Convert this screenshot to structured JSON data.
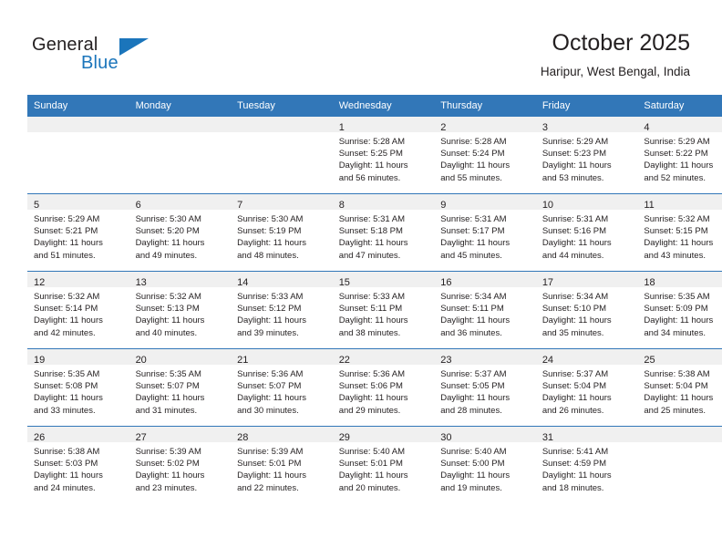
{
  "brand": {
    "line1": "General",
    "line2": "Blue",
    "triangle_color": "#1b75bb"
  },
  "header": {
    "title": "October 2025",
    "subtitle": "Haripur, West Bengal, India"
  },
  "theme": {
    "header_row_bg": "#3277b8",
    "daynum_bar_bg": "#f0f0f0",
    "grid_line": "#3277b8",
    "text": "#231f20"
  },
  "weekday_headers": [
    "Sunday",
    "Monday",
    "Tuesday",
    "Wednesday",
    "Thursday",
    "Friday",
    "Saturday"
  ],
  "labels": {
    "sunrise_prefix": "Sunrise:",
    "sunset_prefix": "Sunset:",
    "daylight_prefix": "Daylight:"
  },
  "weeks": [
    [
      {
        "empty": true
      },
      {
        "empty": true
      },
      {
        "empty": true
      },
      {
        "day": "1",
        "l1": "Sunrise: 5:28 AM",
        "l2": "Sunset: 5:25 PM",
        "l3": "Daylight: 11 hours",
        "l4": "and 56 minutes."
      },
      {
        "day": "2",
        "l1": "Sunrise: 5:28 AM",
        "l2": "Sunset: 5:24 PM",
        "l3": "Daylight: 11 hours",
        "l4": "and 55 minutes."
      },
      {
        "day": "3",
        "l1": "Sunrise: 5:29 AM",
        "l2": "Sunset: 5:23 PM",
        "l3": "Daylight: 11 hours",
        "l4": "and 53 minutes."
      },
      {
        "day": "4",
        "l1": "Sunrise: 5:29 AM",
        "l2": "Sunset: 5:22 PM",
        "l3": "Daylight: 11 hours",
        "l4": "and 52 minutes."
      }
    ],
    [
      {
        "day": "5",
        "l1": "Sunrise: 5:29 AM",
        "l2": "Sunset: 5:21 PM",
        "l3": "Daylight: 11 hours",
        "l4": "and 51 minutes."
      },
      {
        "day": "6",
        "l1": "Sunrise: 5:30 AM",
        "l2": "Sunset: 5:20 PM",
        "l3": "Daylight: 11 hours",
        "l4": "and 49 minutes."
      },
      {
        "day": "7",
        "l1": "Sunrise: 5:30 AM",
        "l2": "Sunset: 5:19 PM",
        "l3": "Daylight: 11 hours",
        "l4": "and 48 minutes."
      },
      {
        "day": "8",
        "l1": "Sunrise: 5:31 AM",
        "l2": "Sunset: 5:18 PM",
        "l3": "Daylight: 11 hours",
        "l4": "and 47 minutes."
      },
      {
        "day": "9",
        "l1": "Sunrise: 5:31 AM",
        "l2": "Sunset: 5:17 PM",
        "l3": "Daylight: 11 hours",
        "l4": "and 45 minutes."
      },
      {
        "day": "10",
        "l1": "Sunrise: 5:31 AM",
        "l2": "Sunset: 5:16 PM",
        "l3": "Daylight: 11 hours",
        "l4": "and 44 minutes."
      },
      {
        "day": "11",
        "l1": "Sunrise: 5:32 AM",
        "l2": "Sunset: 5:15 PM",
        "l3": "Daylight: 11 hours",
        "l4": "and 43 minutes."
      }
    ],
    [
      {
        "day": "12",
        "l1": "Sunrise: 5:32 AM",
        "l2": "Sunset: 5:14 PM",
        "l3": "Daylight: 11 hours",
        "l4": "and 42 minutes."
      },
      {
        "day": "13",
        "l1": "Sunrise: 5:32 AM",
        "l2": "Sunset: 5:13 PM",
        "l3": "Daylight: 11 hours",
        "l4": "and 40 minutes."
      },
      {
        "day": "14",
        "l1": "Sunrise: 5:33 AM",
        "l2": "Sunset: 5:12 PM",
        "l3": "Daylight: 11 hours",
        "l4": "and 39 minutes."
      },
      {
        "day": "15",
        "l1": "Sunrise: 5:33 AM",
        "l2": "Sunset: 5:11 PM",
        "l3": "Daylight: 11 hours",
        "l4": "and 38 minutes."
      },
      {
        "day": "16",
        "l1": "Sunrise: 5:34 AM",
        "l2": "Sunset: 5:11 PM",
        "l3": "Daylight: 11 hours",
        "l4": "and 36 minutes."
      },
      {
        "day": "17",
        "l1": "Sunrise: 5:34 AM",
        "l2": "Sunset: 5:10 PM",
        "l3": "Daylight: 11 hours",
        "l4": "and 35 minutes."
      },
      {
        "day": "18",
        "l1": "Sunrise: 5:35 AM",
        "l2": "Sunset: 5:09 PM",
        "l3": "Daylight: 11 hours",
        "l4": "and 34 minutes."
      }
    ],
    [
      {
        "day": "19",
        "l1": "Sunrise: 5:35 AM",
        "l2": "Sunset: 5:08 PM",
        "l3": "Daylight: 11 hours",
        "l4": "and 33 minutes."
      },
      {
        "day": "20",
        "l1": "Sunrise: 5:35 AM",
        "l2": "Sunset: 5:07 PM",
        "l3": "Daylight: 11 hours",
        "l4": "and 31 minutes."
      },
      {
        "day": "21",
        "l1": "Sunrise: 5:36 AM",
        "l2": "Sunset: 5:07 PM",
        "l3": "Daylight: 11 hours",
        "l4": "and 30 minutes."
      },
      {
        "day": "22",
        "l1": "Sunrise: 5:36 AM",
        "l2": "Sunset: 5:06 PM",
        "l3": "Daylight: 11 hours",
        "l4": "and 29 minutes."
      },
      {
        "day": "23",
        "l1": "Sunrise: 5:37 AM",
        "l2": "Sunset: 5:05 PM",
        "l3": "Daylight: 11 hours",
        "l4": "and 28 minutes."
      },
      {
        "day": "24",
        "l1": "Sunrise: 5:37 AM",
        "l2": "Sunset: 5:04 PM",
        "l3": "Daylight: 11 hours",
        "l4": "and 26 minutes."
      },
      {
        "day": "25",
        "l1": "Sunrise: 5:38 AM",
        "l2": "Sunset: 5:04 PM",
        "l3": "Daylight: 11 hours",
        "l4": "and 25 minutes."
      }
    ],
    [
      {
        "day": "26",
        "l1": "Sunrise: 5:38 AM",
        "l2": "Sunset: 5:03 PM",
        "l3": "Daylight: 11 hours",
        "l4": "and 24 minutes."
      },
      {
        "day": "27",
        "l1": "Sunrise: 5:39 AM",
        "l2": "Sunset: 5:02 PM",
        "l3": "Daylight: 11 hours",
        "l4": "and 23 minutes."
      },
      {
        "day": "28",
        "l1": "Sunrise: 5:39 AM",
        "l2": "Sunset: 5:01 PM",
        "l3": "Daylight: 11 hours",
        "l4": "and 22 minutes."
      },
      {
        "day": "29",
        "l1": "Sunrise: 5:40 AM",
        "l2": "Sunset: 5:01 PM",
        "l3": "Daylight: 11 hours",
        "l4": "and 20 minutes."
      },
      {
        "day": "30",
        "l1": "Sunrise: 5:40 AM",
        "l2": "Sunset: 5:00 PM",
        "l3": "Daylight: 11 hours",
        "l4": "and 19 minutes."
      },
      {
        "day": "31",
        "l1": "Sunrise: 5:41 AM",
        "l2": "Sunset: 4:59 PM",
        "l3": "Daylight: 11 hours",
        "l4": "and 18 minutes."
      },
      {
        "empty": true
      }
    ]
  ]
}
